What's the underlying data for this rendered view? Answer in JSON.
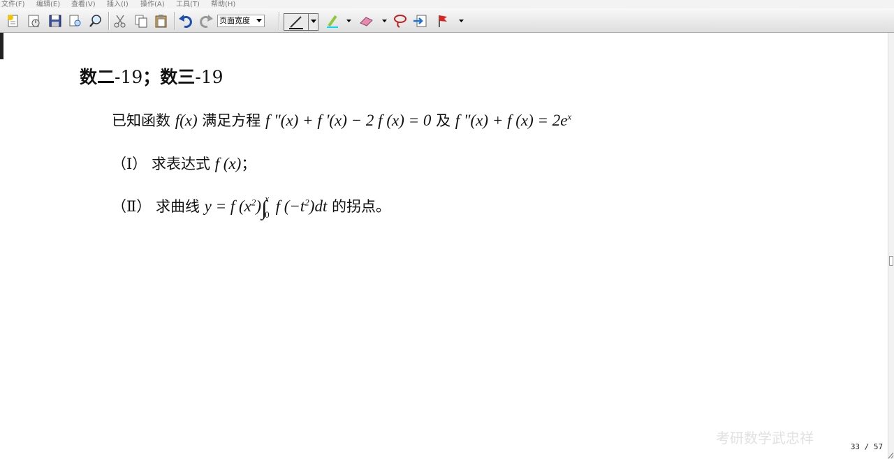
{
  "menu": [
    "文件(F)",
    "编辑(E)",
    "查看(V)",
    "插入(I)",
    "操作(A)",
    "工具(T)",
    "帮助(H)"
  ],
  "toolbar": {
    "zoom_value": "页面宽度",
    "icons": [
      "new-page-icon",
      "open-icon",
      "save-icon",
      "print-preview-icon",
      "find-icon",
      "cut-icon",
      "copy-icon",
      "paste-icon",
      "undo-icon",
      "redo-icon",
      "pen-icon",
      "highlighter-icon",
      "eraser-icon",
      "lasso-icon",
      "insert-space-icon",
      "flag-icon"
    ],
    "accent": "#2060c0"
  },
  "document": {
    "heading_part1": "数二",
    "heading_num1": "-19",
    "heading_sep": "；",
    "heading_part2": "数三",
    "heading_num2": "-19",
    "problem_intro": "已知函数",
    "problem_fx": "f(x)",
    "problem_mid": "满足方程",
    "problem_eq1": "f \"(x) + f '(x) − 2 f (x) = 0",
    "problem_and": "及",
    "problem_eq2": "f \"(x) + f (x) = 2e",
    "problem_eq2_sup": "x",
    "part1_label": "（Ⅰ）",
    "part1_text": "求表达式",
    "part1_fx": "f (x)",
    "part1_end": "；",
    "part2_label": "（Ⅱ）",
    "part2_text": "求曲线",
    "part2_expr_a": "y = f (x",
    "part2_sup_a": "2",
    "part2_expr_b": ")",
    "part2_int_upper": "x",
    "part2_int_lower": "0",
    "part2_expr_c": "f (−t",
    "part2_sup_c": "2",
    "part2_expr_d": ")dt",
    "part2_end": "的拐点。"
  },
  "watermark": "考研数学武忠祥",
  "page_indicator": "33 / 57"
}
